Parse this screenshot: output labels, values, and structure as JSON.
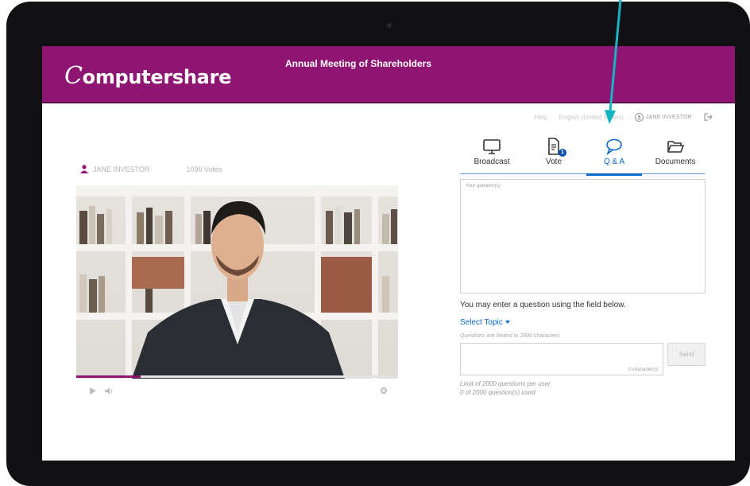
{
  "header": {
    "logo_cap": "C",
    "logo_rest": "omputershare",
    "meeting_title": "Annual Meeting of Shareholders"
  },
  "utility": {
    "help": "Help",
    "language": "English (United States)",
    "user": "JANE INVESTOR"
  },
  "presenter": {
    "name": "JANE INVESTOR",
    "votes": "1096 Votes"
  },
  "video": {
    "progress_fraction": 0.2
  },
  "tabs": [
    {
      "label": "Broadcast",
      "icon": "monitor-icon"
    },
    {
      "label": "Vote",
      "icon": "document-icon",
      "badge": "1"
    },
    {
      "label": "Q & A",
      "icon": "chat-bubble-icon"
    },
    {
      "label": "Documents",
      "icon": "folder-icon"
    }
  ],
  "qa": {
    "box_placeholder": "Your question(s)",
    "hint": "You may enter a question using the field below.",
    "select_topic": "Select Topic",
    "limit_note": "Questions are limited to 2000  characters",
    "char_count": "0 character(s)",
    "send_label": "Send",
    "per_user_limit": "Limit of 2000 questions per user",
    "used_count": "0 of 2000 question(s) used"
  },
  "colors": {
    "brand": "#8e1672",
    "accent": "#0b69c7",
    "annotation_arrow": "#12b5c2"
  }
}
